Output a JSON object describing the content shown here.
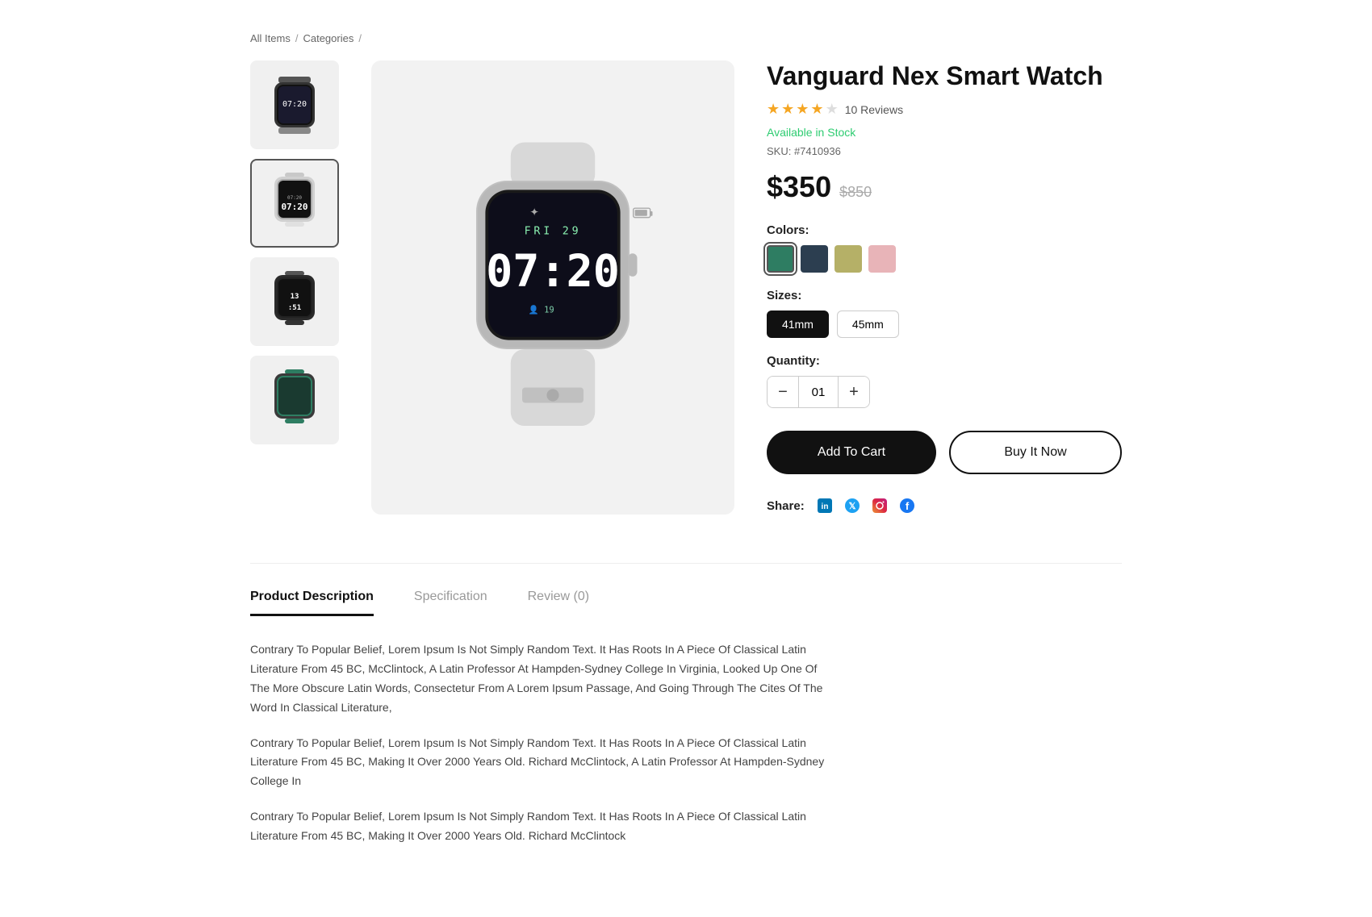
{
  "breadcrumb": {
    "items": [
      {
        "label": "All Items",
        "href": "#"
      },
      {
        "label": "Categories",
        "href": "#"
      }
    ]
  },
  "product": {
    "title": "Vanguard Nex Smart Watch",
    "rating": 4,
    "rating_max": 5,
    "reviews_count": "10 Reviews",
    "stock": "Available in Stock",
    "sku": "SKU: #7410936",
    "price_current": "$350",
    "price_original": "$850",
    "colors_label": "Colors:",
    "colors": [
      {
        "name": "green",
        "hex": "#2e7d62",
        "selected": true
      },
      {
        "name": "navy",
        "hex": "#2c3e50",
        "selected": false
      },
      {
        "name": "olive",
        "hex": "#b5b067",
        "selected": false
      },
      {
        "name": "rose",
        "hex": "#e8b4b8",
        "selected": false
      }
    ],
    "sizes_label": "Sizes:",
    "sizes": [
      {
        "label": "41mm",
        "selected": true
      },
      {
        "label": "45mm",
        "selected": false
      }
    ],
    "quantity_label": "Quantity:",
    "quantity_value": "01",
    "add_to_cart_label": "Add To Cart",
    "buy_now_label": "Buy It Now",
    "share_label": "Share:"
  },
  "tabs": {
    "items": [
      {
        "label": "Product Description",
        "active": true
      },
      {
        "label": "Specification",
        "active": false
      },
      {
        "label": "Review (0)",
        "active": false
      }
    ],
    "description": {
      "paragraphs": [
        "Contrary To Popular Belief, Lorem Ipsum Is Not Simply Random Text. It Has Roots In A Piece Of Classical Latin Literature From 45 BC, McClintock, A Latin Professor At Hampden-Sydney College In Virginia, Looked Up One Of The More Obscure Latin Words, Consectetur From A Lorem Ipsum Passage, And Going Through The Cites Of The Word In Classical Literature,",
        "Contrary To Popular Belief, Lorem Ipsum Is Not Simply Random Text. It Has Roots In A Piece Of Classical Latin Literature From 45 BC, Making It Over 2000 Years Old. Richard McClintock, A Latin Professor At Hampden-Sydney College In",
        "Contrary To Popular Belief, Lorem Ipsum Is Not Simply Random Text. It Has Roots In A Piece Of Classical Latin Literature From 45 BC, Making It Over 2000 Years Old. Richard McClintock"
      ]
    }
  },
  "icons": {
    "linkedin": "in",
    "twitter": "𝕏",
    "instagram": "📷",
    "facebook": "f"
  }
}
